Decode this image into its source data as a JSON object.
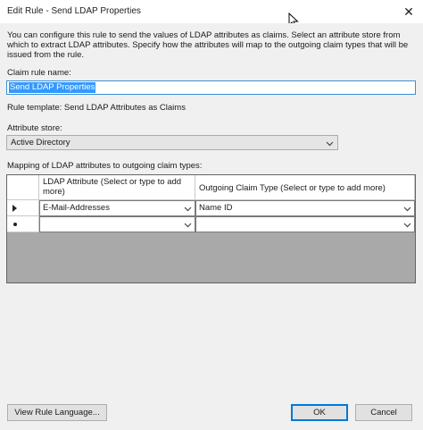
{
  "window": {
    "title": "Edit Rule - Send LDAP Properties",
    "close_glyph": "✕"
  },
  "description": "You can configure this rule to send the values of LDAP attributes as claims. Select an attribute store from which to extract LDAP attributes. Specify how the attributes will map to the outgoing claim types that will be issued from the rule.",
  "claim_rule_name": {
    "label": "Claim rule name:",
    "value": "Send LDAP Properties"
  },
  "rule_template": "Rule template: Send LDAP Attributes as Claims",
  "attribute_store": {
    "label": "Attribute store:",
    "selected": "Active Directory"
  },
  "mapping": {
    "label": "Mapping of LDAP attributes to outgoing claim types:",
    "columns": [
      "LDAP Attribute (Select or type to add more)",
      "Outgoing Claim Type (Select or type to add more)"
    ],
    "rows": [
      {
        "marker": "▶",
        "ldap": "E-Mail-Addresses",
        "claim": "Name ID"
      },
      {
        "marker": "✱",
        "ldap": "",
        "claim": ""
      }
    ]
  },
  "buttons": {
    "view_rule_language": "View Rule Language...",
    "ok": "OK",
    "cancel": "Cancel"
  },
  "icons": {
    "dropdown": "chevron-down-icon",
    "close": "close-icon",
    "cursor": "mouse-pointer-icon"
  }
}
